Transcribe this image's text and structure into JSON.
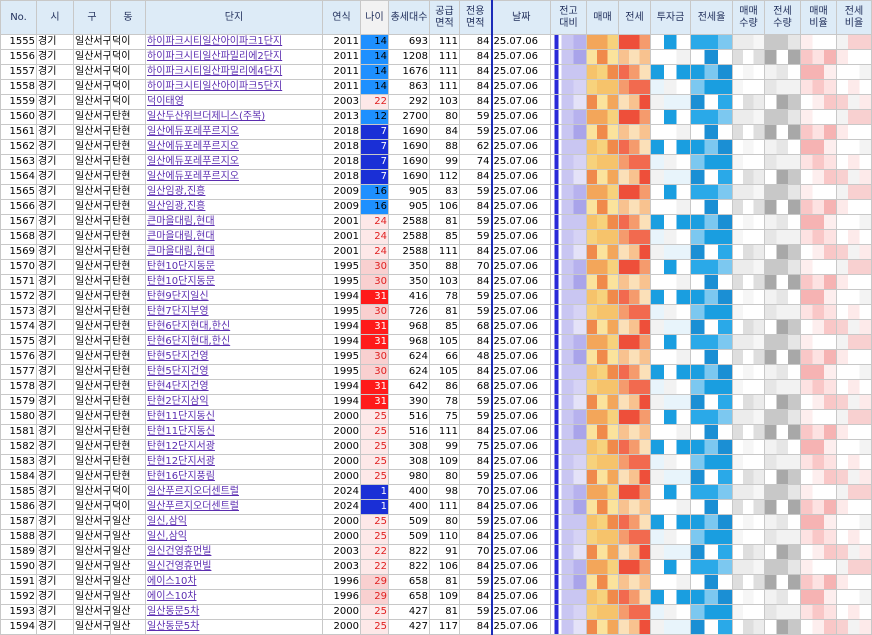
{
  "headers": [
    {
      "label": "No."
    },
    {
      "label": "시"
    },
    {
      "label": "구"
    },
    {
      "label": "동"
    },
    {
      "label": "단지"
    },
    {
      "label": "연식"
    },
    {
      "label": "나이"
    },
    {
      "label": "총세대수"
    },
    {
      "label": "공급\n면적"
    },
    {
      "label": "전용\n면적"
    },
    {
      "label": "날짜"
    },
    {
      "label": "전고\n대비"
    },
    {
      "label": "매매"
    },
    {
      "label": "전세"
    },
    {
      "label": "투자금"
    },
    {
      "label": "전세율"
    },
    {
      "label": "매매\n수량"
    },
    {
      "label": "전세\n수량"
    },
    {
      "label": "매매\n비율"
    },
    {
      "label": "전세\n비율"
    }
  ],
  "rows": [
    {
      "no": "1555",
      "si": "경기",
      "gu": "일산서구",
      "dong": "덕이",
      "name": "하이파크시티일산아이파크1단지",
      "year": "2011",
      "age": "14",
      "units": "693",
      "supply": "111",
      "exclusive": "84",
      "date": "25.07.06"
    },
    {
      "no": "1556",
      "si": "경기",
      "gu": "일산서구",
      "dong": "덕이",
      "name": "하이파크시티일산파밀리에2단지",
      "year": "2011",
      "age": "14",
      "units": "1208",
      "supply": "111",
      "exclusive": "84",
      "date": "25.07.06"
    },
    {
      "no": "1557",
      "si": "경기",
      "gu": "일산서구",
      "dong": "덕이",
      "name": "하이파크시티일산파밀리에4단지",
      "year": "2011",
      "age": "14",
      "units": "1676",
      "supply": "111",
      "exclusive": "84",
      "date": "25.07.06"
    },
    {
      "no": "1558",
      "si": "경기",
      "gu": "일산서구",
      "dong": "덕이",
      "name": "하이파크시티일산아이파크5단지",
      "year": "2011",
      "age": "14",
      "units": "863",
      "supply": "111",
      "exclusive": "84",
      "date": "25.07.06"
    },
    {
      "no": "1559",
      "si": "경기",
      "gu": "일산서구",
      "dong": "덕이",
      "name": "덕이태영",
      "year": "2003",
      "age": "22",
      "units": "292",
      "supply": "103",
      "exclusive": "84",
      "date": "25.07.06"
    },
    {
      "no": "1560",
      "si": "경기",
      "gu": "일산서구",
      "dong": "탄현",
      "name": "일산두산위브더제니스(주복)",
      "year": "2013",
      "age": "12",
      "units": "2700",
      "supply": "80",
      "exclusive": "59",
      "date": "25.07.06"
    },
    {
      "no": "1561",
      "si": "경기",
      "gu": "일산서구",
      "dong": "탄현",
      "name": "일산에듀포레푸르지오",
      "year": "2018",
      "age": "7",
      "units": "1690",
      "supply": "84",
      "exclusive": "59",
      "date": "25.07.06"
    },
    {
      "no": "1562",
      "si": "경기",
      "gu": "일산서구",
      "dong": "탄현",
      "name": "일산에듀포레푸르지오",
      "year": "2018",
      "age": "7",
      "units": "1690",
      "supply": "88",
      "exclusive": "62",
      "date": "25.07.06"
    },
    {
      "no": "1563",
      "si": "경기",
      "gu": "일산서구",
      "dong": "탄현",
      "name": "일산에듀포레푸르지오",
      "year": "2018",
      "age": "7",
      "units": "1690",
      "supply": "99",
      "exclusive": "74",
      "date": "25.07.06"
    },
    {
      "no": "1564",
      "si": "경기",
      "gu": "일산서구",
      "dong": "탄현",
      "name": "일산에듀포레푸르지오",
      "year": "2018",
      "age": "7",
      "units": "1690",
      "supply": "112",
      "exclusive": "84",
      "date": "25.07.06"
    },
    {
      "no": "1565",
      "si": "경기",
      "gu": "일산서구",
      "dong": "탄현",
      "name": "일산임광,진흥",
      "year": "2009",
      "age": "16",
      "units": "905",
      "supply": "83",
      "exclusive": "59",
      "date": "25.07.06"
    },
    {
      "no": "1566",
      "si": "경기",
      "gu": "일산서구",
      "dong": "탄현",
      "name": "일산임광,진흥",
      "year": "2009",
      "age": "16",
      "units": "905",
      "supply": "106",
      "exclusive": "84",
      "date": "25.07.06"
    },
    {
      "no": "1567",
      "si": "경기",
      "gu": "일산서구",
      "dong": "탄현",
      "name": "큰마을대림,현대",
      "year": "2001",
      "age": "24",
      "units": "2588",
      "supply": "81",
      "exclusive": "59",
      "date": "25.07.06"
    },
    {
      "no": "1568",
      "si": "경기",
      "gu": "일산서구",
      "dong": "탄현",
      "name": "큰마을대림,현대",
      "year": "2001",
      "age": "24",
      "units": "2588",
      "supply": "85",
      "exclusive": "59",
      "date": "25.07.06"
    },
    {
      "no": "1569",
      "si": "경기",
      "gu": "일산서구",
      "dong": "탄현",
      "name": "큰마을대림,현대",
      "year": "2001",
      "age": "24",
      "units": "2588",
      "supply": "111",
      "exclusive": "84",
      "date": "25.07.06"
    },
    {
      "no": "1570",
      "si": "경기",
      "gu": "일산서구",
      "dong": "탄현",
      "name": "탄현10단지동문",
      "year": "1995",
      "age": "30",
      "units": "350",
      "supply": "88",
      "exclusive": "70",
      "date": "25.07.06"
    },
    {
      "no": "1571",
      "si": "경기",
      "gu": "일산서구",
      "dong": "탄현",
      "name": "탄현10단지동문",
      "year": "1995",
      "age": "30",
      "units": "350",
      "supply": "103",
      "exclusive": "84",
      "date": "25.07.06"
    },
    {
      "no": "1572",
      "si": "경기",
      "gu": "일산서구",
      "dong": "탄현",
      "name": "탄현9단지일신",
      "year": "1994",
      "age": "31",
      "units": "416",
      "supply": "78",
      "exclusive": "59",
      "date": "25.07.06"
    },
    {
      "no": "1573",
      "si": "경기",
      "gu": "일산서구",
      "dong": "탄현",
      "name": "탄현7단지부영",
      "year": "1995",
      "age": "30",
      "units": "726",
      "supply": "81",
      "exclusive": "59",
      "date": "25.07.06"
    },
    {
      "no": "1574",
      "si": "경기",
      "gu": "일산서구",
      "dong": "탄현",
      "name": "탄현6단지현대,한신",
      "year": "1994",
      "age": "31",
      "units": "968",
      "supply": "85",
      "exclusive": "68",
      "date": "25.07.06"
    },
    {
      "no": "1575",
      "si": "경기",
      "gu": "일산서구",
      "dong": "탄현",
      "name": "탄현6단지현대,한신",
      "year": "1994",
      "age": "31",
      "units": "968",
      "supply": "105",
      "exclusive": "84",
      "date": "25.07.06"
    },
    {
      "no": "1576",
      "si": "경기",
      "gu": "일산서구",
      "dong": "탄현",
      "name": "탄현5단지건영",
      "year": "1995",
      "age": "30",
      "units": "624",
      "supply": "66",
      "exclusive": "48",
      "date": "25.07.06"
    },
    {
      "no": "1577",
      "si": "경기",
      "gu": "일산서구",
      "dong": "탄현",
      "name": "탄현5단지건영",
      "year": "1995",
      "age": "30",
      "units": "624",
      "supply": "105",
      "exclusive": "84",
      "date": "25.07.06"
    },
    {
      "no": "1578",
      "si": "경기",
      "gu": "일산서구",
      "dong": "탄현",
      "name": "탄현4단지건영",
      "year": "1994",
      "age": "31",
      "units": "642",
      "supply": "86",
      "exclusive": "68",
      "date": "25.07.06"
    },
    {
      "no": "1579",
      "si": "경기",
      "gu": "일산서구",
      "dong": "탄현",
      "name": "탄현2단지삼익",
      "year": "1994",
      "age": "31",
      "units": "390",
      "supply": "78",
      "exclusive": "59",
      "date": "25.07.06"
    },
    {
      "no": "1580",
      "si": "경기",
      "gu": "일산서구",
      "dong": "탄현",
      "name": "탄현11단지동신",
      "year": "2000",
      "age": "25",
      "units": "516",
      "supply": "75",
      "exclusive": "59",
      "date": "25.07.06"
    },
    {
      "no": "1581",
      "si": "경기",
      "gu": "일산서구",
      "dong": "탄현",
      "name": "탄현11단지동신",
      "year": "2000",
      "age": "25",
      "units": "516",
      "supply": "111",
      "exclusive": "84",
      "date": "25.07.06"
    },
    {
      "no": "1582",
      "si": "경기",
      "gu": "일산서구",
      "dong": "탄현",
      "name": "탄현12단지서광",
      "year": "2000",
      "age": "25",
      "units": "308",
      "supply": "99",
      "exclusive": "75",
      "date": "25.07.06"
    },
    {
      "no": "1583",
      "si": "경기",
      "gu": "일산서구",
      "dong": "탄현",
      "name": "탄현12단지서광",
      "year": "2000",
      "age": "25",
      "units": "308",
      "supply": "109",
      "exclusive": "84",
      "date": "25.07.06"
    },
    {
      "no": "1584",
      "si": "경기",
      "gu": "일산서구",
      "dong": "탄현",
      "name": "탄현16단지풍림",
      "year": "2000",
      "age": "25",
      "units": "980",
      "supply": "80",
      "exclusive": "59",
      "date": "25.07.06"
    },
    {
      "no": "1585",
      "si": "경기",
      "gu": "일산서구",
      "dong": "덕이",
      "name": "일산푸르지오더센트럴",
      "year": "2024",
      "age": "1",
      "units": "400",
      "supply": "98",
      "exclusive": "70",
      "date": "25.07.06"
    },
    {
      "no": "1586",
      "si": "경기",
      "gu": "일산서구",
      "dong": "덕이",
      "name": "일산푸르지오더센트럴",
      "year": "2024",
      "age": "1",
      "units": "400",
      "supply": "111",
      "exclusive": "84",
      "date": "25.07.06"
    },
    {
      "no": "1587",
      "si": "경기",
      "gu": "일산서구",
      "dong": "일산",
      "name": "일신,삼익",
      "year": "2000",
      "age": "25",
      "units": "509",
      "supply": "80",
      "exclusive": "59",
      "date": "25.07.06"
    },
    {
      "no": "1588",
      "si": "경기",
      "gu": "일산서구",
      "dong": "일산",
      "name": "일신,삼익",
      "year": "2000",
      "age": "25",
      "units": "509",
      "supply": "110",
      "exclusive": "84",
      "date": "25.07.06"
    },
    {
      "no": "1589",
      "si": "경기",
      "gu": "일산서구",
      "dong": "일산",
      "name": "일신건영휴먼빌",
      "year": "2003",
      "age": "22",
      "units": "822",
      "supply": "91",
      "exclusive": "70",
      "date": "25.07.06"
    },
    {
      "no": "1590",
      "si": "경기",
      "gu": "일산서구",
      "dong": "일산",
      "name": "일신건영휴먼빌",
      "year": "2003",
      "age": "22",
      "units": "822",
      "supply": "106",
      "exclusive": "84",
      "date": "25.07.06"
    },
    {
      "no": "1591",
      "si": "경기",
      "gu": "일산서구",
      "dong": "일산",
      "name": "에이스10차",
      "year": "1996",
      "age": "29",
      "units": "658",
      "supply": "81",
      "exclusive": "59",
      "date": "25.07.06"
    },
    {
      "no": "1592",
      "si": "경기",
      "gu": "일산서구",
      "dong": "일산",
      "name": "에이스10차",
      "year": "1996",
      "age": "29",
      "units": "658",
      "supply": "109",
      "exclusive": "84",
      "date": "25.07.06"
    },
    {
      "no": "1593",
      "si": "경기",
      "gu": "일산서구",
      "dong": "일산",
      "name": "일산동문5차",
      "year": "2000",
      "age": "25",
      "units": "427",
      "supply": "81",
      "exclusive": "59",
      "date": "25.07.06"
    },
    {
      "no": "1594",
      "si": "경기",
      "gu": "일산서구",
      "dong": "일산",
      "name": "일산동문5차",
      "year": "2000",
      "age": "25",
      "units": "427",
      "supply": "117",
      "exclusive": "84",
      "date": "25.07.06"
    }
  ],
  "colors": {
    "header_bg": "#ddebf7",
    "header_text": "#1f2d5a",
    "link": "#5b2db0",
    "age_blue": "#1e90ff",
    "age_navy": "#1a2fd6",
    "age_pink": "#f9d0d0",
    "age_red": "#ff1a1a",
    "date_border": "#1c2bb8"
  }
}
